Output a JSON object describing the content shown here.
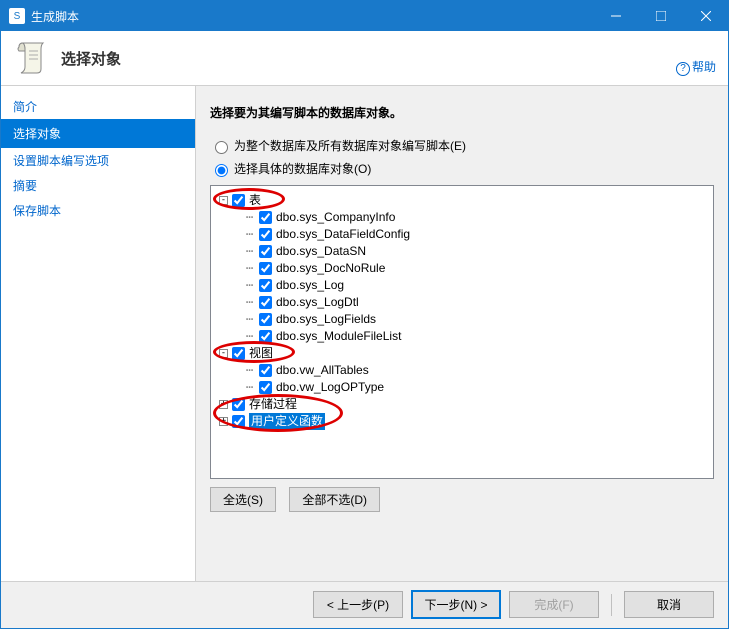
{
  "titlebar": {
    "title": "生成脚本"
  },
  "header": {
    "title": "选择对象"
  },
  "help": {
    "label": "帮助"
  },
  "sidebar": {
    "items": [
      {
        "label": "简介"
      },
      {
        "label": "选择对象"
      },
      {
        "label": "设置脚本编写选项"
      },
      {
        "label": "摘要"
      },
      {
        "label": "保存脚本"
      }
    ]
  },
  "content": {
    "heading": "选择要为其编写脚本的数据库对象。",
    "radio_all": "为整个数据库及所有数据库对象编写脚本(E)",
    "radio_specific": "选择具体的数据库对象(O)",
    "btn_select_all": "全选(S)",
    "btn_deselect_all": "全部不选(D)"
  },
  "tree": {
    "tables": {
      "label": "表",
      "items": [
        "dbo.sys_CompanyInfo",
        "dbo.sys_DataFieldConfig",
        "dbo.sys_DataSN",
        "dbo.sys_DocNoRule",
        "dbo.sys_Log",
        "dbo.sys_LogDtl",
        "dbo.sys_LogFields",
        "dbo.sys_ModuleFileList"
      ]
    },
    "views": {
      "label": "视图",
      "items": [
        "dbo.vw_AllTables",
        "dbo.vw_LogOPType"
      ]
    },
    "procs": {
      "label": "存储过程"
    },
    "funcs": {
      "label": "用户定义函数"
    }
  },
  "footer": {
    "prev": "< 上一步(P)",
    "next": "下一步(N) >",
    "finish": "完成(F)",
    "cancel": "取消"
  }
}
